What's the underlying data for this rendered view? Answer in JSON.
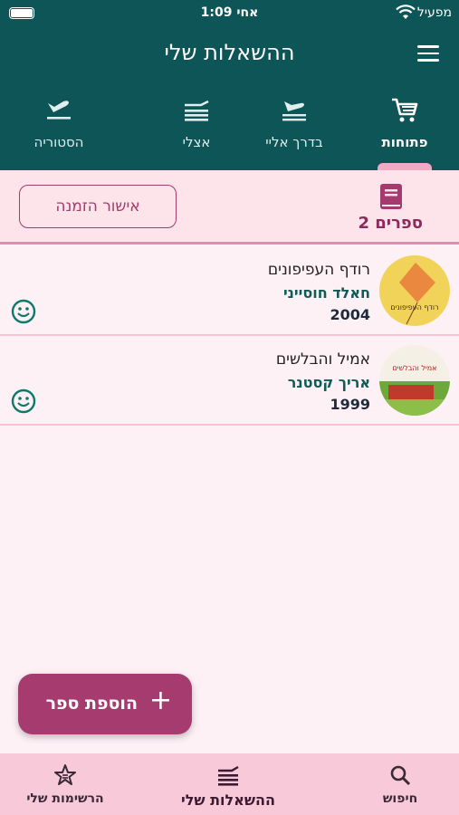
{
  "status": {
    "time": "1:09 אחי",
    "carrier": "מפעיל"
  },
  "header": {
    "title": "ההשאלות שלי"
  },
  "tabs": [
    {
      "label": "פתוחות",
      "icon": "cart-icon",
      "active": true
    },
    {
      "label": "בדרך אליי",
      "icon": "landing-plane-icon"
    },
    {
      "label": "אצלי",
      "icon": "book-stack-icon"
    },
    {
      "label": "הסטוריה",
      "icon": "takeoff-plane-icon"
    }
  ],
  "summary": {
    "count": "2 ספרים",
    "confirm_label": "אישור הזמנה"
  },
  "books": [
    {
      "title": "רודף העפיפונים",
      "author": "חאלד חוסייני",
      "year": "2004",
      "cover_text": "רודף העפיפונים"
    },
    {
      "title": "אמיל והבלשים",
      "author": "אריך קסטנר",
      "year": "1999",
      "cover_text": "אמיל והבלשים"
    }
  ],
  "fab": {
    "label": "הוספת ספר",
    "plus": "+"
  },
  "bottom_nav": [
    {
      "label": "חיפוש",
      "icon": "search-icon"
    },
    {
      "label": "ההשאלות שלי",
      "icon": "book-stack-icon",
      "active": true
    },
    {
      "label": "הרשימות שלי",
      "icon": "star-list-icon"
    }
  ],
  "colors": {
    "primary": "#0d5557",
    "accent": "#a53b6e",
    "pink_bg": "#fde3ea"
  }
}
